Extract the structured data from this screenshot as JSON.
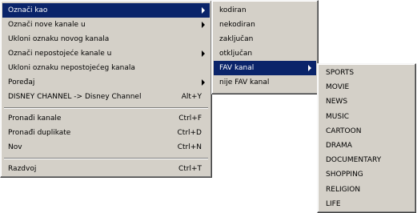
{
  "main_menu": {
    "items": [
      {
        "label": "Označi kao",
        "shortcut": "",
        "submenu": true,
        "highlighted": true
      },
      {
        "label": "Označi nove kanale u",
        "shortcut": "",
        "submenu": true,
        "highlighted": false
      },
      {
        "label": "Ukloni oznaku novog kanala",
        "shortcut": "",
        "submenu": false,
        "highlighted": false
      },
      {
        "label": "Označi nepostojeće kanale u",
        "shortcut": "",
        "submenu": true,
        "highlighted": false
      },
      {
        "label": "Ukloni oznaku nepostojećeg kanala",
        "shortcut": "",
        "submenu": false,
        "highlighted": false
      },
      {
        "label": "Poređaj",
        "shortcut": "",
        "submenu": true,
        "highlighted": false
      },
      {
        "label": "DISNEY CHANNEL -> Disney Channel",
        "shortcut": "Alt+Y",
        "submenu": false,
        "highlighted": false
      },
      {
        "label": "Pronađi kanale",
        "shortcut": "Ctrl+F",
        "submenu": false,
        "highlighted": false
      },
      {
        "label": "Pronađi duplikate",
        "shortcut": "Ctrl+D",
        "submenu": false,
        "highlighted": false
      },
      {
        "label": "Nov",
        "shortcut": "Ctrl+N",
        "submenu": false,
        "highlighted": false
      },
      {
        "label": "Razdvoj",
        "shortcut": "Ctrl+T",
        "submenu": false,
        "highlighted": false
      }
    ]
  },
  "submenu_mark_as": {
    "items": [
      {
        "label": "kodiran",
        "submenu": false,
        "highlighted": false
      },
      {
        "label": "nekodiran",
        "submenu": false,
        "highlighted": false
      },
      {
        "label": "zaključan",
        "submenu": false,
        "highlighted": false
      },
      {
        "label": "otključan",
        "submenu": false,
        "highlighted": false
      },
      {
        "label": "FAV kanal",
        "submenu": true,
        "highlighted": true
      },
      {
        "label": "nije FAV kanal",
        "submenu": false,
        "highlighted": false
      }
    ]
  },
  "submenu_fav": {
    "items": [
      "SPORTS",
      "MOVIE",
      "NEWS",
      "MUSIC",
      "CARTOON",
      "DRAMA",
      "DOCUMENTARY",
      "SHOPPING",
      "RELIGION",
      "LIFE"
    ]
  },
  "colors": {
    "menu_bg": "#d4d0c8",
    "highlight_bg": "#0a246a",
    "highlight_text": "#ffffff"
  }
}
